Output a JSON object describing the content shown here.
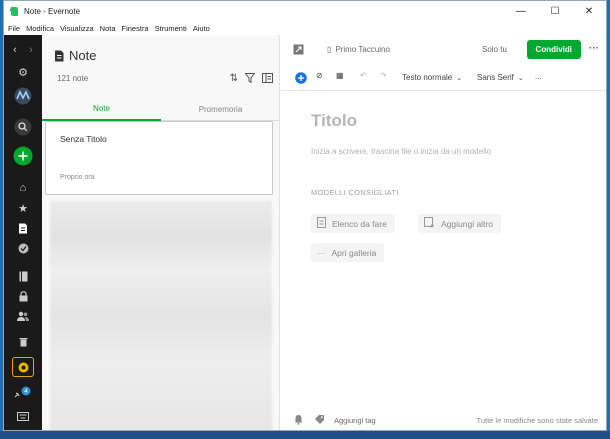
{
  "window": {
    "title": "Note - Evernote"
  },
  "menu": {
    "items": [
      "File",
      "Modifica",
      "Visualizza",
      "Nota",
      "Finestra",
      "Strumenti",
      "Aiuto"
    ]
  },
  "sidebar": {
    "badge_count": "4"
  },
  "notelist": {
    "title": "Note",
    "count": "121 note",
    "tabs": [
      "Note",
      "Promemoria"
    ],
    "selected_note": {
      "title": "Senza Titolo",
      "date": "Proprio ora"
    }
  },
  "editor": {
    "notebook": "Primo Taccuino",
    "only_you": "Solo tu",
    "share_label": "Condividi",
    "more_label": "···",
    "text_style": "Testo normale",
    "font": "Sans Serif",
    "toolbar_more": "...",
    "title_placeholder": "Titolo",
    "hint": "Inizia a scrivere, trascina file o inizia da un modello",
    "templates_heading": "MODELLI CONSIGLIATI",
    "templates": [
      "Elenco da fare",
      "Aggiungi altro",
      "Apri galleria"
    ],
    "add_tag": "Aggiungi tag",
    "status": "Tutte le modifiche sono state salvate"
  },
  "colors": {
    "accent": "#00a82d",
    "sidebar": "#1a1a1a"
  }
}
